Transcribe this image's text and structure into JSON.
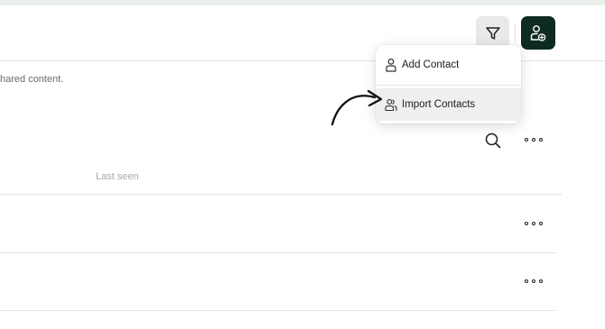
{
  "description_fragment": "hared content.",
  "table": {
    "column_headers": [
      "Last seen"
    ]
  },
  "menu": {
    "items": [
      {
        "label": "Add Contact",
        "icon": "person-icon"
      },
      {
        "label": "Import Contacts",
        "icon": "people-icon"
      }
    ]
  },
  "colors": {
    "primary_button": "#0d2b22",
    "filter_button_bg": "#e8eae9",
    "highlight_row": "#efefef"
  }
}
